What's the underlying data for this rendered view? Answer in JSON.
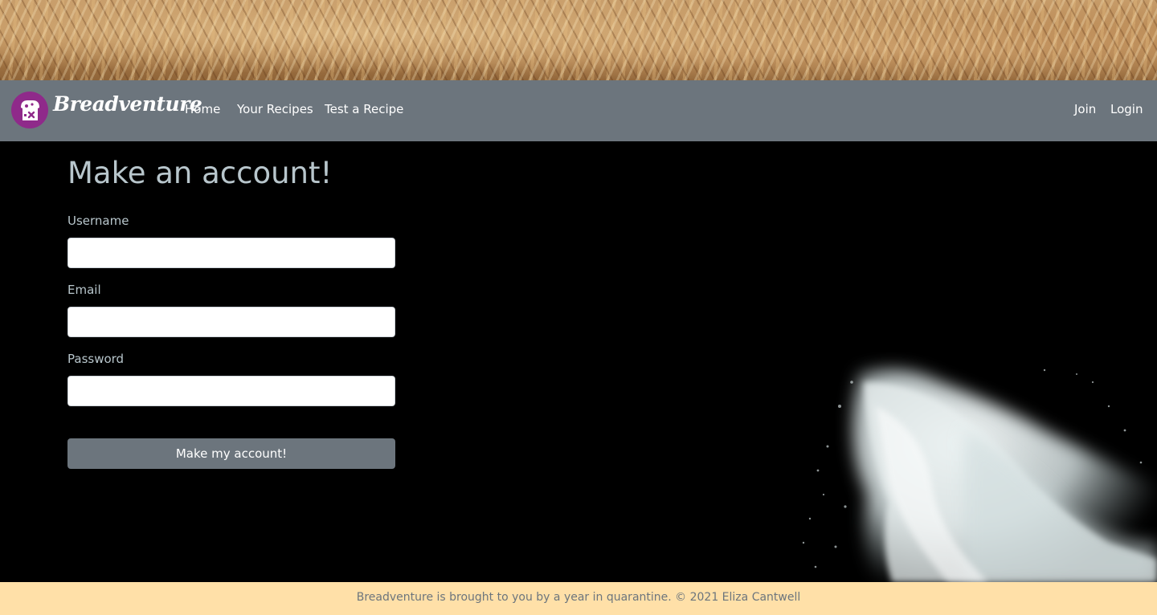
{
  "brand": {
    "name": "Breadventure",
    "logo_icon": "bread-slice-icon",
    "logo_color": "#8f2a8a"
  },
  "nav": {
    "left": [
      "Home",
      "Your Recipes",
      "Test a Recipe"
    ],
    "right": [
      "Join",
      "Login"
    ],
    "background": "#6c757d"
  },
  "form": {
    "title": "Make an account!",
    "fields": [
      {
        "label": "Username",
        "value": "",
        "placeholder": ""
      },
      {
        "label": "Email",
        "value": "",
        "placeholder": ""
      },
      {
        "label": "Password",
        "value": "",
        "placeholder": ""
      }
    ],
    "submit_label": "Make my account!"
  },
  "footer": {
    "text": "Breadventure is brought to you by a year in quarantine. © 2021 Eliza Cantwell",
    "background": "#ffe0a8"
  },
  "colors": {
    "heading": "#b8c6cc",
    "page_background": "#000000"
  }
}
